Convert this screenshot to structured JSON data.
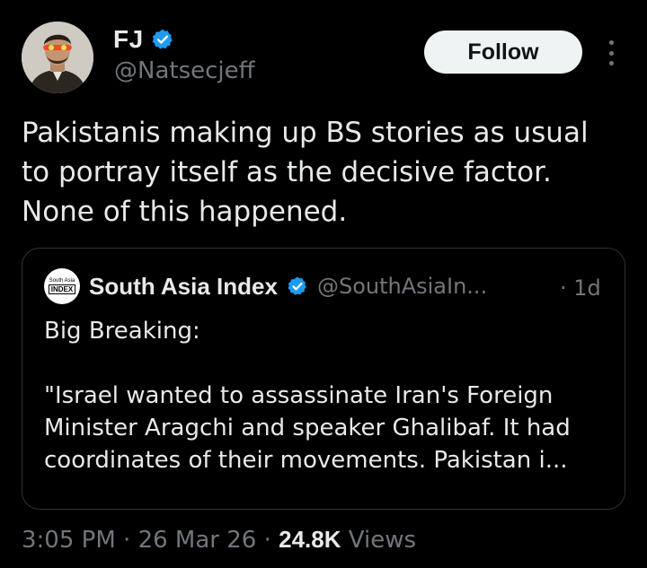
{
  "author": {
    "display_name": "FJ",
    "handle": "@Natsecjeff",
    "avatar_icon": "profile-photo-icon",
    "verified_icon": "verified-badge-icon"
  },
  "follow_label": "Follow",
  "more_icon": "more-options-icon",
  "tweet_text": "Pakistanis making up BS stories as usual\nto portray itself as the decisive factor.\nNone of this happened.",
  "quote": {
    "avatar_small_text": "South Asia",
    "avatar_big_text": "INDEX",
    "name": "South Asia Index",
    "handle": "@SouthAsiaIn...",
    "time": "· 1d",
    "text": "Big Breaking:\n\n\"Israel wanted to assassinate Iran's Foreign\nMinister Aragchi and speaker Ghalibaf. It had\ncoordinates of their movements. Pakistan i..."
  },
  "meta": {
    "time": "3:05 PM",
    "sep1": " · ",
    "date": "26 Mar 26",
    "sep2": " · ",
    "views_count": "24.8K",
    "views_label": " Views"
  },
  "colors": {
    "background": "#000000",
    "text_primary": "#e7e9ea",
    "text_secondary": "#71767b",
    "verified": "#1d9bf0",
    "border": "#2f3336"
  }
}
